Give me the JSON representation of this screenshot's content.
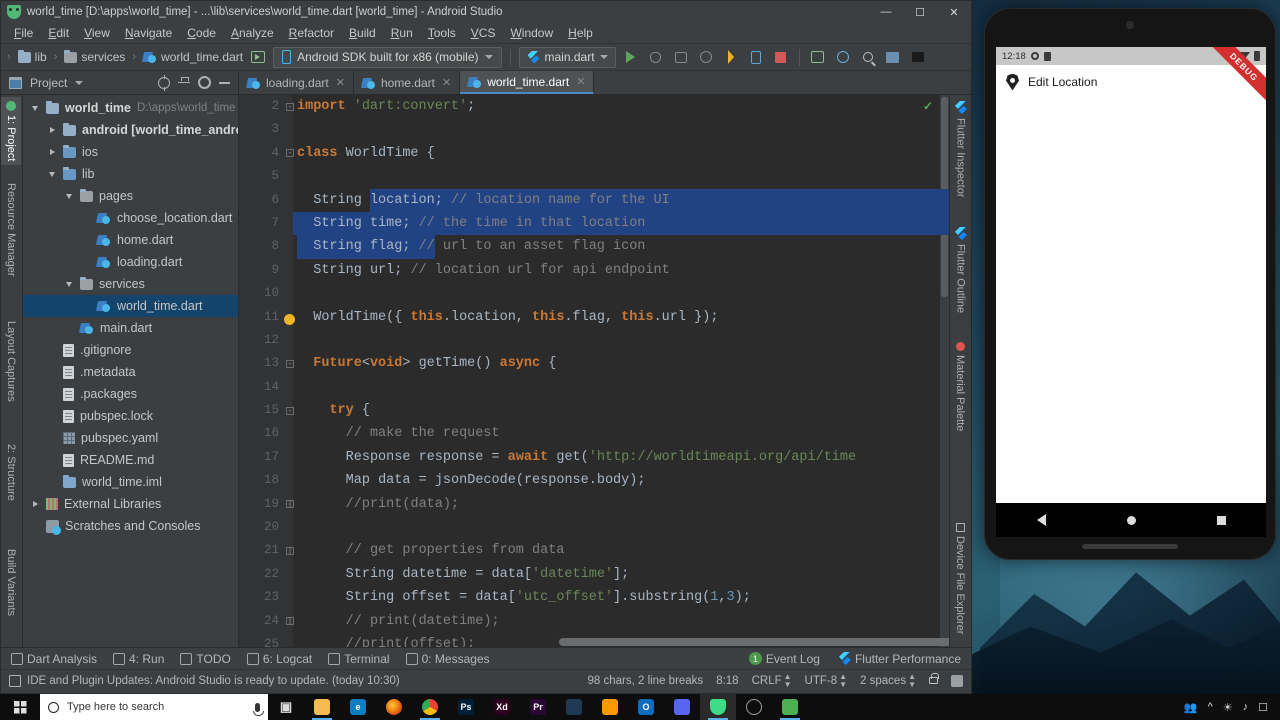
{
  "window": {
    "title": "world_time [D:\\apps\\world_time] - ...\\lib\\services\\world_time.dart [world_time] - Android Studio",
    "minimize": "—",
    "maximize": "☐",
    "close": "✕"
  },
  "menubar": [
    "File",
    "Edit",
    "View",
    "Navigate",
    "Code",
    "Analyze",
    "Refactor",
    "Build",
    "Run",
    "Tools",
    "VCS",
    "Window",
    "Help"
  ],
  "toolbar": {
    "breadcrumb": [
      "lib",
      "services",
      "world_time.dart"
    ],
    "device": "Android SDK built for x86 (mobile)",
    "run_config": "main.dart"
  },
  "tabs": [
    {
      "label": "loading.dart",
      "active": false
    },
    {
      "label": "home.dart",
      "active": false
    },
    {
      "label": "world_time.dart",
      "active": true
    }
  ],
  "left_tool_tabs": [
    "1: Project",
    "Resource Manager",
    "Layout Captures",
    "2: Structure",
    "Build Variants"
  ],
  "right_tool_tabs": [
    "Flutter Inspector",
    "Flutter Outline",
    "Material Palette",
    "Device File Explorer"
  ],
  "project_panel": {
    "label": "Project",
    "tree": [
      {
        "depth": 0,
        "arrow": "down",
        "icon": "module",
        "label": "world_time",
        "bold": true,
        "path": "D:\\apps\\world_time",
        "selected": false
      },
      {
        "depth": 1,
        "arrow": "right",
        "icon": "module",
        "label": "android [world_time_android]",
        "bold": true,
        "path": "",
        "selected": false
      },
      {
        "depth": 1,
        "arrow": "right",
        "icon": "folder",
        "label": "ios",
        "bold": false,
        "path": "",
        "selected": false
      },
      {
        "depth": 1,
        "arrow": "down",
        "icon": "folder",
        "label": "lib",
        "bold": false,
        "path": "",
        "selected": false
      },
      {
        "depth": 2,
        "arrow": "down",
        "icon": "pkg",
        "label": "pages",
        "bold": false,
        "path": "",
        "selected": false
      },
      {
        "depth": 3,
        "arrow": "none",
        "icon": "dart",
        "label": "choose_location.dart",
        "bold": false,
        "path": "",
        "selected": false
      },
      {
        "depth": 3,
        "arrow": "none",
        "icon": "dart",
        "label": "home.dart",
        "bold": false,
        "path": "",
        "selected": false
      },
      {
        "depth": 3,
        "arrow": "none",
        "icon": "dart",
        "label": "loading.dart",
        "bold": false,
        "path": "",
        "selected": false
      },
      {
        "depth": 2,
        "arrow": "down",
        "icon": "pkg",
        "label": "services",
        "bold": false,
        "path": "",
        "selected": false
      },
      {
        "depth": 3,
        "arrow": "none",
        "icon": "dart",
        "label": "world_time.dart",
        "bold": false,
        "path": "",
        "selected": true
      },
      {
        "depth": 2,
        "arrow": "none",
        "icon": "dart",
        "label": "main.dart",
        "bold": false,
        "path": "",
        "selected": false
      },
      {
        "depth": 1,
        "arrow": "none",
        "icon": "file",
        "label": ".gitignore",
        "bold": false,
        "path": "",
        "selected": false
      },
      {
        "depth": 1,
        "arrow": "none",
        "icon": "file",
        "label": ".metadata",
        "bold": false,
        "path": "",
        "selected": false
      },
      {
        "depth": 1,
        "arrow": "none",
        "icon": "file",
        "label": ".packages",
        "bold": false,
        "path": "",
        "selected": false
      },
      {
        "depth": 1,
        "arrow": "none",
        "icon": "file",
        "label": "pubspec.lock",
        "bold": false,
        "path": "",
        "selected": false
      },
      {
        "depth": 1,
        "arrow": "none",
        "icon": "yaml",
        "label": "pubspec.yaml",
        "bold": false,
        "path": "",
        "selected": false
      },
      {
        "depth": 1,
        "arrow": "none",
        "icon": "file",
        "label": "README.md",
        "bold": false,
        "path": "",
        "selected": false
      },
      {
        "depth": 1,
        "arrow": "none",
        "icon": "iml",
        "label": "world_time.iml",
        "bold": false,
        "path": "",
        "selected": false
      },
      {
        "depth": 0,
        "arrow": "right",
        "icon": "lib",
        "label": "External Libraries",
        "bold": false,
        "path": "",
        "selected": false
      },
      {
        "depth": 0,
        "arrow": "none",
        "icon": "scratch",
        "label": "Scratches and Consoles",
        "bold": false,
        "path": "",
        "selected": false
      }
    ]
  },
  "editor": {
    "first_line": 2,
    "lines": [
      {
        "n": 2,
        "text": "import 'dart:convert';"
      },
      {
        "n": 3,
        "text": ""
      },
      {
        "n": 4,
        "text": "class WorldTime {"
      },
      {
        "n": 5,
        "text": ""
      },
      {
        "n": 6,
        "text": "  String location; // location name for the UI"
      },
      {
        "n": 7,
        "text": "  String time; // the time in that location"
      },
      {
        "n": 8,
        "text": "  String flag; // url to an asset flag icon"
      },
      {
        "n": 9,
        "text": "  String url; // location url for api endpoint"
      },
      {
        "n": 10,
        "text": ""
      },
      {
        "n": 11,
        "text": "  WorldTime({ this.location, this.flag, this.url });"
      },
      {
        "n": 12,
        "text": ""
      },
      {
        "n": 13,
        "text": "  Future<void> getTime() async {"
      },
      {
        "n": 14,
        "text": ""
      },
      {
        "n": 15,
        "text": "    try {"
      },
      {
        "n": 16,
        "text": "      // make the request"
      },
      {
        "n": 17,
        "text": "      Response response = await get('http://worldtimeapi.org/api/time"
      },
      {
        "n": 18,
        "text": "      Map data = jsonDecode(response.body);"
      },
      {
        "n": 19,
        "text": "      //print(data);"
      },
      {
        "n": 20,
        "text": ""
      },
      {
        "n": 21,
        "text": "      // get properties from data"
      },
      {
        "n": 22,
        "text": "      String datetime = data['datetime'];"
      },
      {
        "n": 23,
        "text": "      String offset = data['utc_offset'].substring(1,3);"
      },
      {
        "n": 24,
        "text": "      // print(datetime);"
      },
      {
        "n": 25,
        "text": "      //print(offset);"
      }
    ]
  },
  "bottom_tools": [
    {
      "label": "Dart Analysis",
      "icon": "dart-icon"
    },
    {
      "label": "4: Run",
      "icon": "run-icon"
    },
    {
      "label": "TODO",
      "icon": "todo-icon"
    },
    {
      "label": "6: Logcat",
      "icon": "logcat-icon"
    },
    {
      "label": "Terminal",
      "icon": "terminal-icon"
    },
    {
      "label": "0: Messages",
      "icon": "messages-icon"
    }
  ],
  "bottom_tools_right": [
    {
      "label": "Event Log",
      "badge": "1"
    },
    {
      "label": "Flutter Performance",
      "badge": ""
    }
  ],
  "statusbar": {
    "message": "IDE and Plugin Updates: Android Studio is ready to update. (today 10:30)",
    "selection": "98 chars, 2 line breaks",
    "caret": "8:18",
    "line_sep": "CRLF",
    "encoding": "UTF-8",
    "indent": "2 spaces"
  },
  "emulator": {
    "status_time": "12:18",
    "app_title": "Edit Location",
    "debug_ribbon": "DEBUG",
    "nav": [
      "back",
      "home",
      "recents"
    ]
  },
  "taskbar": {
    "search_placeholder": "Type here to search",
    "apps": [
      {
        "name": "task-view-icon",
        "label": "",
        "color": "#0d0d0d",
        "text": "▣"
      },
      {
        "name": "file-explorer-icon",
        "label": "",
        "color": "#f5bd4f",
        "text": ""
      },
      {
        "name": "edge-icon",
        "label": "e",
        "color": "#0e7ec1",
        "text": "e"
      },
      {
        "name": "firefox-icon",
        "label": "",
        "color": "#e66000",
        "text": ""
      },
      {
        "name": "chrome-icon",
        "label": "",
        "color": "#4285f4",
        "text": ""
      },
      {
        "name": "photoshop-icon",
        "label": "Ps",
        "color": "#001e36",
        "text": "Ps"
      },
      {
        "name": "adobe-xd-icon",
        "label": "Xd",
        "color": "#2e001e",
        "text": "Xd"
      },
      {
        "name": "premiere-icon",
        "label": "Pr",
        "color": "#2a0634",
        "text": "Pr"
      },
      {
        "name": "vscode-icon",
        "label": "",
        "color": "#1f3a55",
        "text": ""
      },
      {
        "name": "sublime-text-icon",
        "label": "",
        "color": "#ff9800",
        "text": ""
      },
      {
        "name": "outlook-icon",
        "label": "o",
        "color": "#0f6cbd",
        "text": "O"
      },
      {
        "name": "discord-icon",
        "label": "",
        "color": "#5865f2",
        "text": ""
      },
      {
        "name": "android-studio-icon",
        "label": "",
        "color": "#3ddc84",
        "text": ""
      },
      {
        "name": "browser-icon",
        "label": "",
        "color": "#3a3a3a",
        "text": ""
      },
      {
        "name": "app-icon",
        "label": "",
        "color": "#4caf50",
        "text": ""
      }
    ],
    "tray": [
      "people-icon",
      "chevron-up-icon",
      "wifi-icon",
      "volume-icon",
      "action-center-icon"
    ]
  }
}
